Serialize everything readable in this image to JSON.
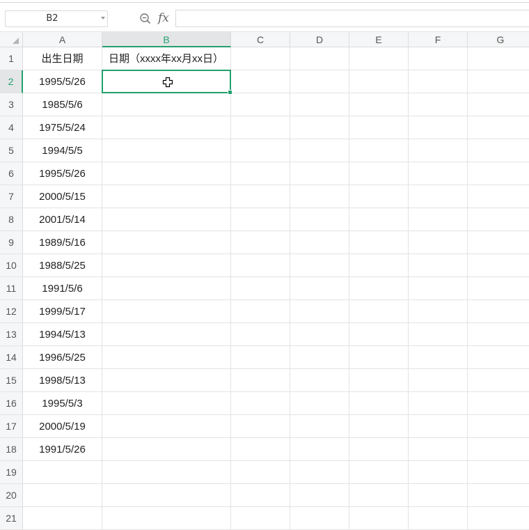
{
  "name_box": {
    "value": "B2"
  },
  "formula_bar": {
    "fx_label": "fx",
    "value": ""
  },
  "columns": [
    "A",
    "B",
    "C",
    "D",
    "E",
    "F",
    "G"
  ],
  "rows": [
    {
      "num": "1",
      "a": "出生日期",
      "b": "日期（xxxx年xx月xx日）"
    },
    {
      "num": "2",
      "a": "1995/5/26",
      "b": ""
    },
    {
      "num": "3",
      "a": "1985/5/6",
      "b": ""
    },
    {
      "num": "4",
      "a": "1975/5/24",
      "b": ""
    },
    {
      "num": "5",
      "a": "1994/5/5",
      "b": ""
    },
    {
      "num": "6",
      "a": "1995/5/26",
      "b": ""
    },
    {
      "num": "7",
      "a": "2000/5/15",
      "b": ""
    },
    {
      "num": "8",
      "a": "2001/5/14",
      "b": ""
    },
    {
      "num": "9",
      "a": "1989/5/16",
      "b": ""
    },
    {
      "num": "10",
      "a": "1988/5/25",
      "b": ""
    },
    {
      "num": "11",
      "a": "1991/5/6",
      "b": ""
    },
    {
      "num": "12",
      "a": "1999/5/17",
      "b": ""
    },
    {
      "num": "13",
      "a": "1994/5/13",
      "b": ""
    },
    {
      "num": "14",
      "a": "1996/5/25",
      "b": ""
    },
    {
      "num": "15",
      "a": "1998/5/13",
      "b": ""
    },
    {
      "num": "16",
      "a": "1995/5/3",
      "b": ""
    },
    {
      "num": "17",
      "a": "2000/5/19",
      "b": ""
    },
    {
      "num": "18",
      "a": "1991/5/26",
      "b": ""
    },
    {
      "num": "19",
      "a": "",
      "b": ""
    },
    {
      "num": "20",
      "a": "",
      "b": ""
    },
    {
      "num": "21",
      "a": "",
      "b": ""
    }
  ],
  "selected_cell": "B2",
  "accent_color": "#23a06f",
  "icons": {
    "zoom": "zoom-out-icon",
    "fx": "function-icon",
    "dropdown": "chevron-down-icon",
    "cursor": "cross-cursor-icon"
  }
}
